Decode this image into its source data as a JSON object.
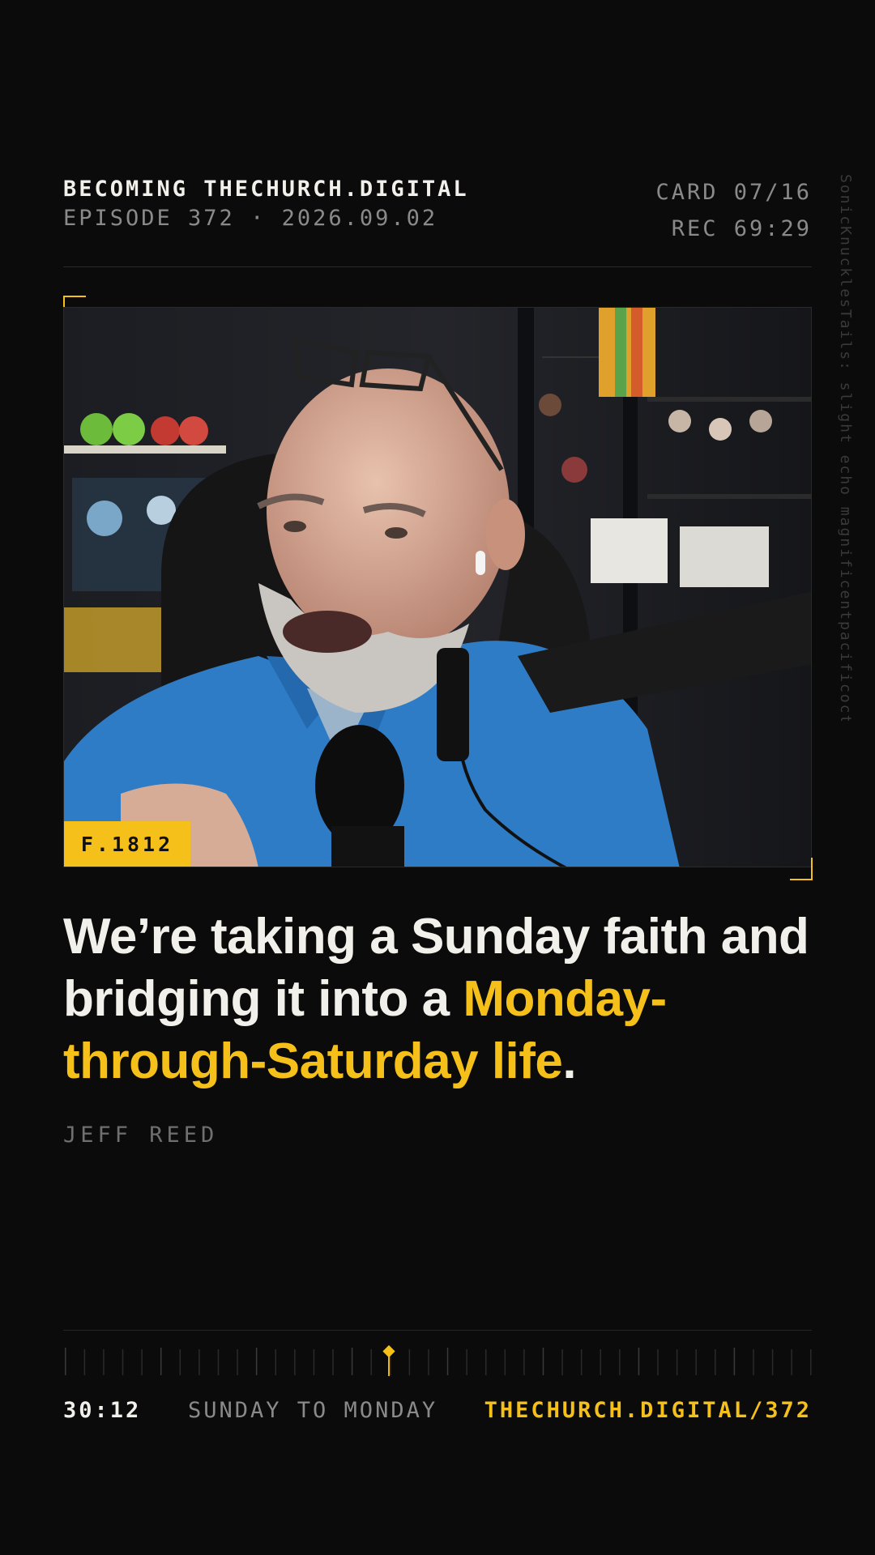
{
  "header": {
    "show_title": "BECOMING THECHURCH.DIGITAL",
    "episode_line": "EPISODE 372 · 2026.09.02",
    "card_count": "CARD 07/16",
    "rec_time": "REC 69:29"
  },
  "side_caption": "SonicKnucklesTails: slight echo magnificentpacificoctopus",
  "video_frame": {
    "frame_tag": "F.1812",
    "image_description": "Bald bearded man in blue polo shirt speaking into a black podcast microphone on a boom arm, glasses on head, shelves of collectible figures in background"
  },
  "quote": {
    "part1": "We’re taking a Sunday faith and bridging it into a ",
    "highlight": "Monday-through-Saturday life",
    "end": "."
  },
  "speaker": "JEFF REED",
  "footer": {
    "time": "30:12",
    "label": "SUNDAY TO MONDAY",
    "url": "THECHURCH.DIGITAL/372",
    "progress": 0.435
  },
  "colors": {
    "accent": "#f5c01a",
    "background": "#0b0b0b",
    "text": "#f2f0ea",
    "muted": "#8a8a8a"
  }
}
